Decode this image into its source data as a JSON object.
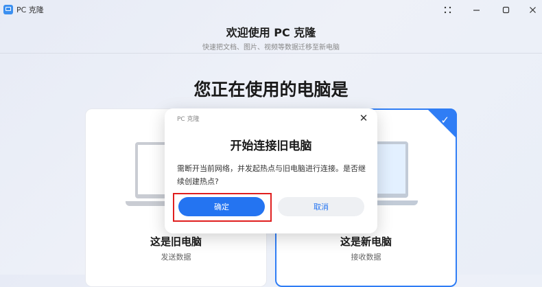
{
  "window": {
    "title": "PC 克隆",
    "controls": [
      "grid-icon",
      "minimize-icon",
      "maximize-icon",
      "close-icon"
    ]
  },
  "header": {
    "title": "欢迎使用 PC 克隆",
    "subtitle": "快速把文档、图片、视频等数据迁移至新电脑"
  },
  "main": {
    "title": "您正在使用的电脑是",
    "cards": [
      {
        "title": "这是旧电脑",
        "subtitle": "发送数据",
        "selected": false
      },
      {
        "title": "这是新电脑",
        "subtitle": "接收数据",
        "selected": true
      }
    ]
  },
  "dialog": {
    "app_name": "PC 克隆",
    "title": "开始连接旧电脑",
    "message": "需断开当前网络，并发起热点与旧电脑进行连接。是否继续创建热点?",
    "confirm_label": "确定",
    "cancel_label": "取消",
    "close_glyph": "✕"
  },
  "colors": {
    "accent": "#2474f1",
    "highlight": "#e01e1e"
  }
}
